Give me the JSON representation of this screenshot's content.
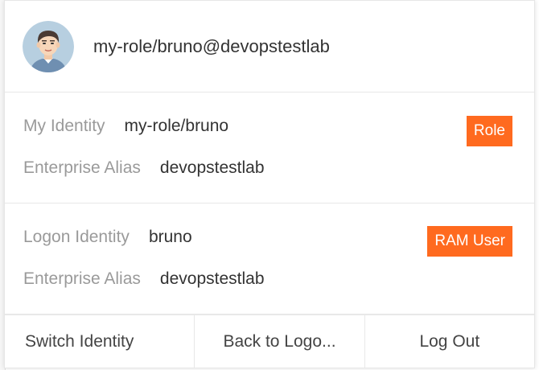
{
  "header": {
    "account_name": "my-role/bruno@devopstestlab"
  },
  "my_identity": {
    "identity_label": "My Identity",
    "identity_value": "my-role/bruno",
    "alias_label": "Enterprise Alias",
    "alias_value": "devopstestlab",
    "badge": "Role"
  },
  "logon_identity": {
    "identity_label": "Logon Identity",
    "identity_value": "bruno",
    "alias_label": "Enterprise Alias",
    "alias_value": "devopstestlab",
    "badge": "RAM User"
  },
  "footer": {
    "switch_label": "Switch Identity",
    "back_label": "Back to Logo...",
    "logout_label": "Log Out"
  },
  "colors": {
    "badge": "#ff6a1f",
    "label": "#9a9a9a",
    "text": "#333333"
  }
}
